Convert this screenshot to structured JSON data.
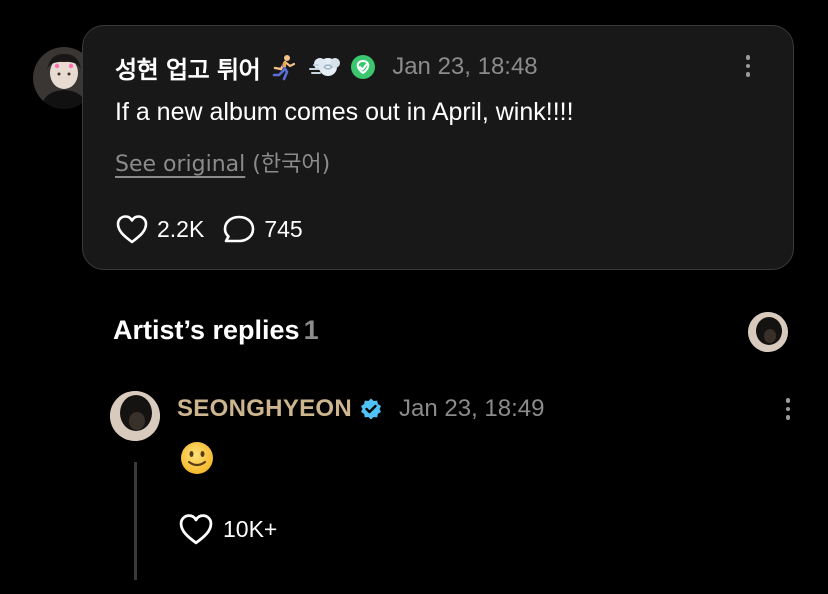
{
  "post": {
    "username": "성현 업고 튀어",
    "emoji_icons": [
      "running-person-icon",
      "dash-icon"
    ],
    "timestamp": "Jan 23, 18:48",
    "text": "If a new album comes out in April, wink!!!!",
    "see_original": "See original",
    "original_language": "(한국어)",
    "likes": "2.2K",
    "comments": "745"
  },
  "artist_replies": {
    "title": "Artist’s replies",
    "count": "1"
  },
  "reply": {
    "name": "SEONGHYEON",
    "timestamp": "Jan 23, 18:49",
    "text": "🙂",
    "likes": "10K+"
  },
  "colors": {
    "background": "#000000",
    "card": "#181818",
    "muted_text": "#8b8b8b",
    "artist_name": "#cdb58e",
    "verified_green": "#3cc66f",
    "verified_blue": "#4fc3f7"
  }
}
